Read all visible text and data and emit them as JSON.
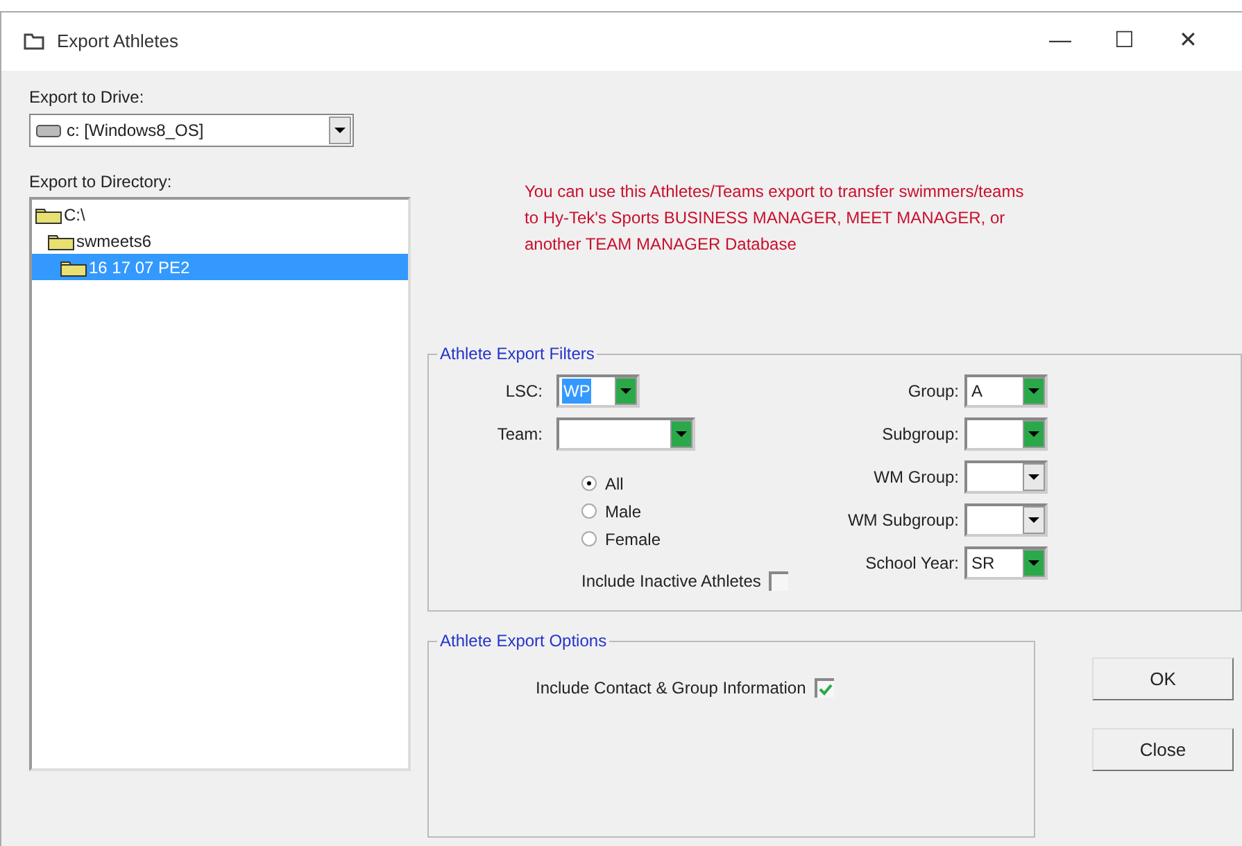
{
  "window": {
    "title": "Export Athletes",
    "controls": [
      "—",
      "☐",
      "✕"
    ]
  },
  "drive": {
    "label": "Export to Drive:",
    "value": "c: [Windows8_OS]"
  },
  "directory": {
    "label": "Export to Directory:",
    "tree": [
      {
        "label": "C:\\",
        "selected": false,
        "children": [
          {
            "label": "swmeets6",
            "selected": false,
            "children": [
              {
                "label": "16 17 07 PE2",
                "selected": true
              }
            ]
          }
        ]
      }
    ]
  },
  "notice": "You can use this Athletes/Teams export to transfer swimmers/teams to Hy-Tek's Sports BUSINESS MANAGER, MEET MANAGER, or another TEAM MANAGER Database",
  "filters": {
    "title": "Athlete Export Filters",
    "left_combos": [
      {
        "label": "LSC:",
        "value": "WP",
        "highlighted": true,
        "value_selected": true
      },
      {
        "label": "Team:",
        "highlighted": true
      }
    ],
    "gender": [
      {
        "label": "All",
        "selected": true
      },
      {
        "label": "Male",
        "selected": false
      },
      {
        "label": "Female",
        "selected": false
      }
    ],
    "include_inactive": {
      "label": "Include Inactive Athletes",
      "checked": false
    },
    "right_combos": [
      {
        "label": "Group:",
        "value": "A",
        "highlighted": true
      },
      {
        "label": "Subgroup:",
        "highlighted": true
      },
      {
        "label": "WM Group:",
        "highlighted": false
      },
      {
        "label": "WM Subgroup:",
        "highlighted": false
      },
      {
        "label": "School Year:",
        "value": "SR",
        "highlighted": true
      }
    ]
  },
  "options": {
    "title": "Athlete Export Options",
    "include_contact": {
      "label": "Include Contact & Group Information",
      "checked": true
    }
  },
  "buttons": [
    "OK",
    "Close"
  ]
}
